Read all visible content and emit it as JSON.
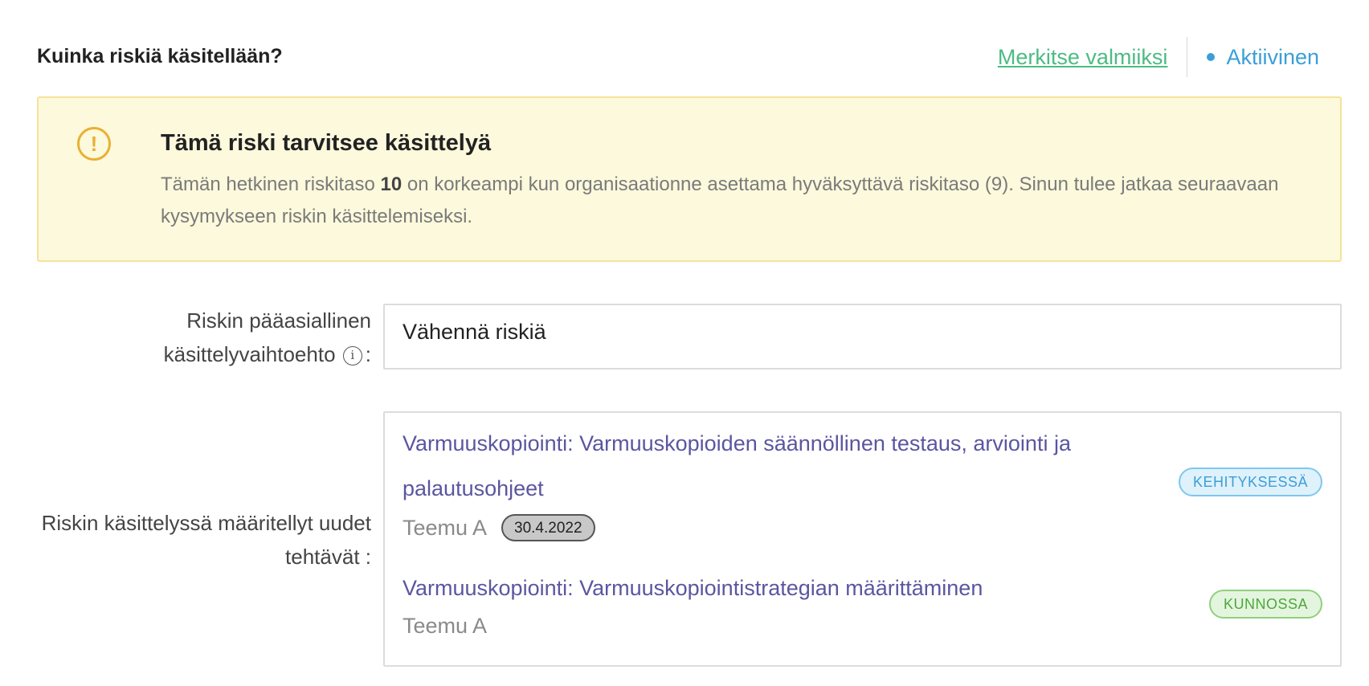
{
  "header": {
    "title": "Kuinka riskiä käsitellään?",
    "mark_done_label": "Merkitse valmiiksi",
    "status_label": "Aktiivinen"
  },
  "alert": {
    "title": "Tämä riski tarvitsee käsittelyä",
    "text_before": "Tämän hetkinen riskitaso ",
    "risk_level": "10",
    "text_after": " on korkeampi kun organisaationne asettama hyväksyttävä riskitaso (9). Sinun tulee jatkaa seuraavaan kysymykseen riskin käsittelemiseksi.",
    "icon": "exclamation-circle-icon"
  },
  "treatment": {
    "label_line1": "Riskin pääasiallinen",
    "label_line2": "käsittelyvaihtoehto",
    "label_suffix": ":",
    "value": "Vähennä riskiä"
  },
  "tasks_section": {
    "label_line1": "Riskin käsittelyssä määritellyt uudet",
    "label_line2": "tehtävät :",
    "tasks": [
      {
        "title": "Varmuuskopiointi: Varmuuskopioiden säännöllinen testaus, arviointi ja palautusohjeet",
        "assignee": "Teemu A",
        "due_date": "30.4.2022",
        "status": "KEHITYKSESSÄ"
      },
      {
        "title": "Varmuuskopiointi: Varmuuskopiointistrategian määrittäminen",
        "assignee": "Teemu A",
        "status": "KUNNOSSA"
      }
    ]
  },
  "colors": {
    "accent_green": "#4cbb84",
    "accent_blue": "#3a9fd8",
    "task_link": "#5a56a0",
    "alert_bg": "#fdf9dc",
    "alert_border": "#f5e29a"
  }
}
